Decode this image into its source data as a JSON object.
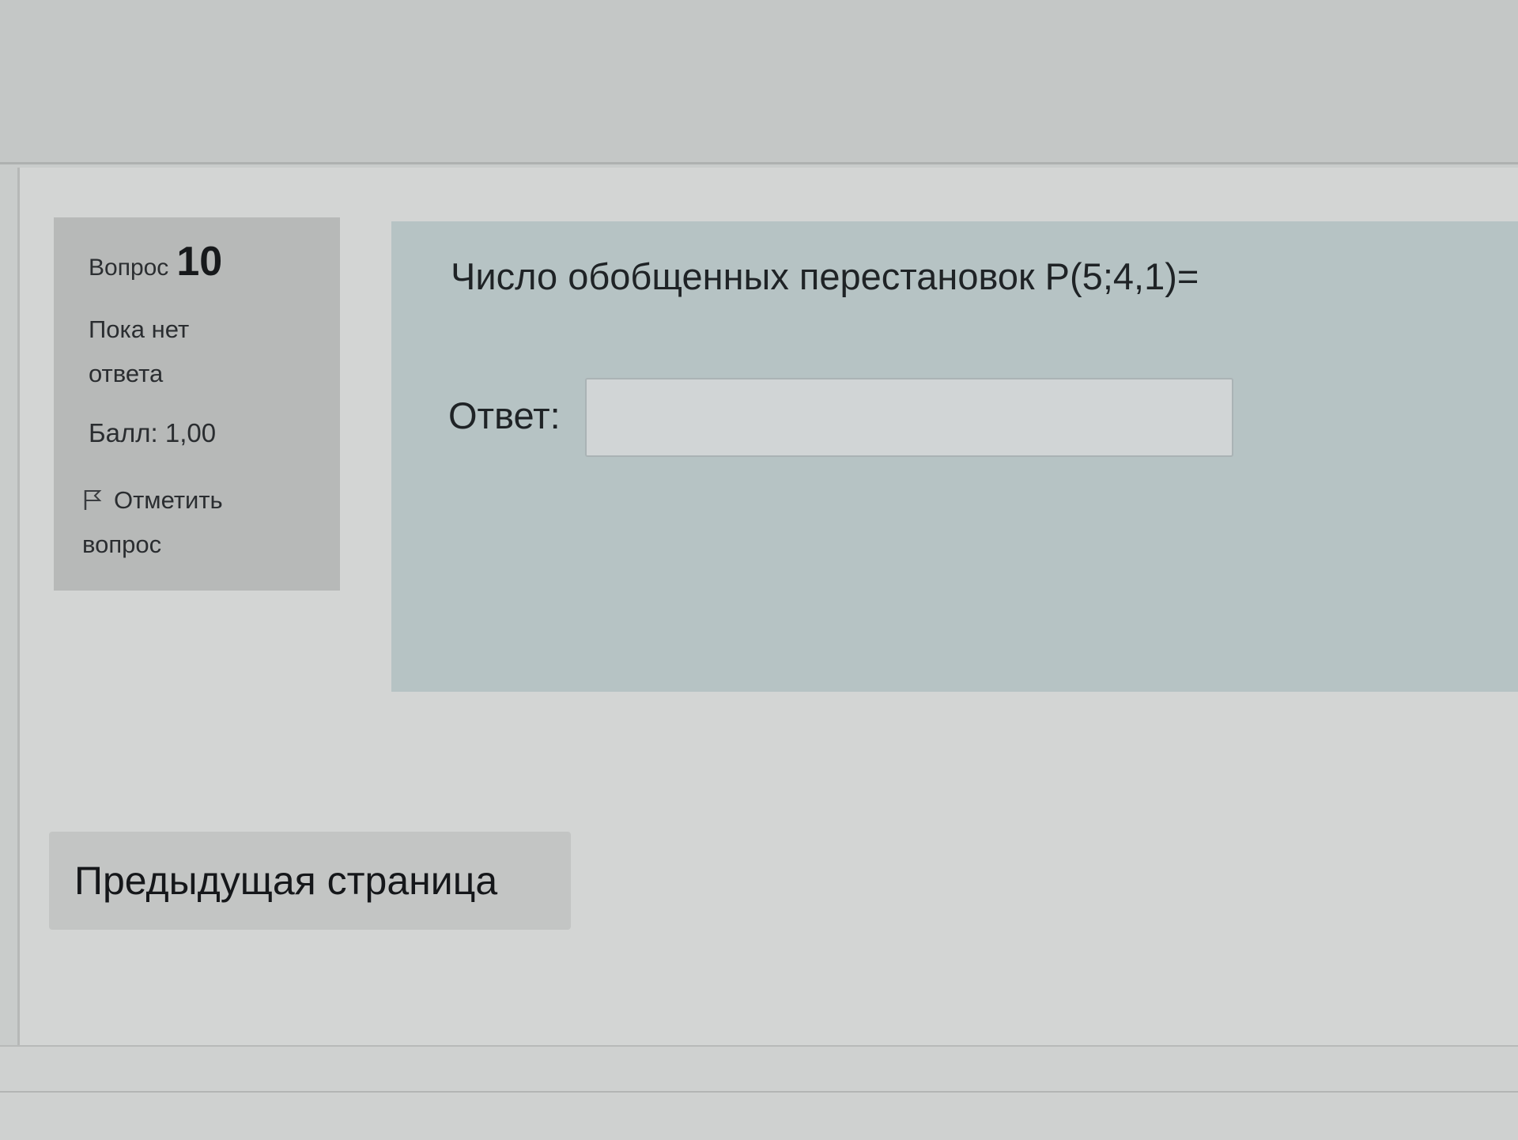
{
  "question_info": {
    "label": "Вопрос",
    "number": "10",
    "state": "Пока нет ответа",
    "grade": "Балл: 1,00",
    "flag_label": "Отметить вопрос",
    "flag_icon": "flag-icon"
  },
  "question": {
    "text": "Число обобщенных перестановок P(5;4,1)=",
    "answer_label": "Ответ:",
    "answer_value": ""
  },
  "navigation": {
    "previous_page_label": "Предыдущая страница"
  }
}
